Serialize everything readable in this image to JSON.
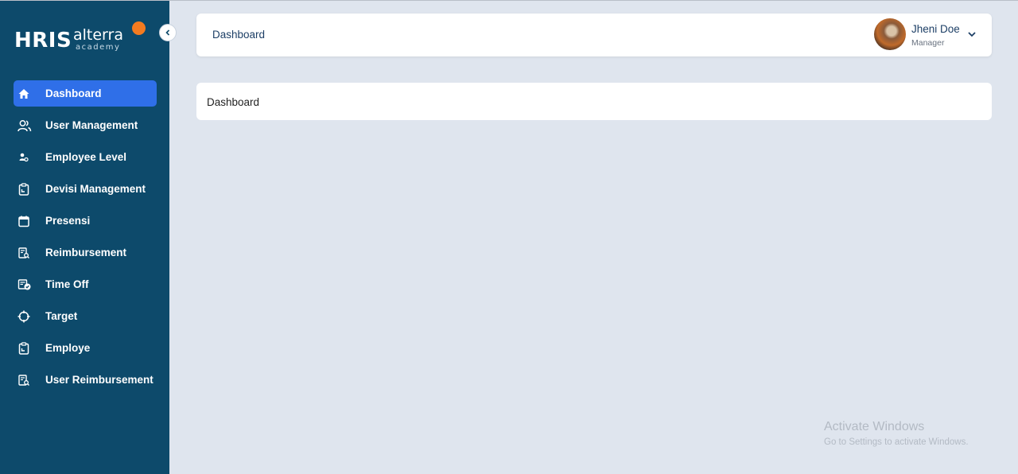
{
  "logo": {
    "brand": "HRIS",
    "name": "alterra",
    "sub": "academy"
  },
  "sidebar": {
    "items": [
      {
        "label": "Dashboard",
        "icon": "home-icon",
        "active": true
      },
      {
        "label": "User Management",
        "icon": "users-icon"
      },
      {
        "label": "Employee Level",
        "icon": "person-level-icon"
      },
      {
        "label": "Devisi Management",
        "icon": "clipboard-icon"
      },
      {
        "label": "Presensi",
        "icon": "calendar-icon"
      },
      {
        "label": "Reimbursement",
        "icon": "receipt-search-icon"
      },
      {
        "label": "Time Off",
        "icon": "calendar-check-icon"
      },
      {
        "label": "Target",
        "icon": "crosshair-icon"
      },
      {
        "label": "Employe",
        "icon": "clipboard-icon"
      },
      {
        "label": "User Reimbursement",
        "icon": "receipt-search-icon"
      }
    ]
  },
  "header": {
    "title": "Dashboard",
    "user": {
      "name": "Jheni Doe",
      "role": "Manager"
    }
  },
  "main": {
    "card_title": "Dashboard"
  },
  "watermark": {
    "title": "Activate Windows",
    "subtitle": "Go to Settings to activate Windows."
  },
  "colors": {
    "sidebar": "#0d4a6b",
    "active": "#2f6fe8",
    "background": "#dfe5ee",
    "logo_dot": "#f47b20"
  }
}
